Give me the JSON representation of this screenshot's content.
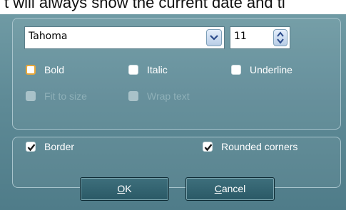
{
  "top_text": "t will always show the current date and ti",
  "font": {
    "family_value": "Tahoma",
    "dropdown_icon": "chevron-down-icon",
    "size_value": "11",
    "spinner_icon": "up-down-arrows-icon"
  },
  "style_options": {
    "bold": {
      "label": "Bold",
      "checked": false,
      "focused": true
    },
    "italic": {
      "label": "Italic",
      "checked": false
    },
    "underline": {
      "label": "Underline",
      "checked": false
    }
  },
  "layout_options": {
    "fit_to_size": {
      "label": "Fit to size",
      "enabled": false
    },
    "wrap_text": {
      "label": "Wrap text",
      "enabled": false
    }
  },
  "frame_options": {
    "border": {
      "label": "Border",
      "checked": true
    },
    "rounded_corners": {
      "label": "Rounded corners",
      "checked": true
    }
  },
  "buttons": {
    "ok_label": "OK",
    "ok_mnemonic": "O",
    "ok_rest": "K",
    "cancel_label": "Cancel",
    "cancel_mnemonic": "C",
    "cancel_rest": "ancel"
  },
  "colors": {
    "dialog_bg": "#5e8a96",
    "focus_ring": "#e8a73a",
    "button_bg": "#2a5966"
  }
}
